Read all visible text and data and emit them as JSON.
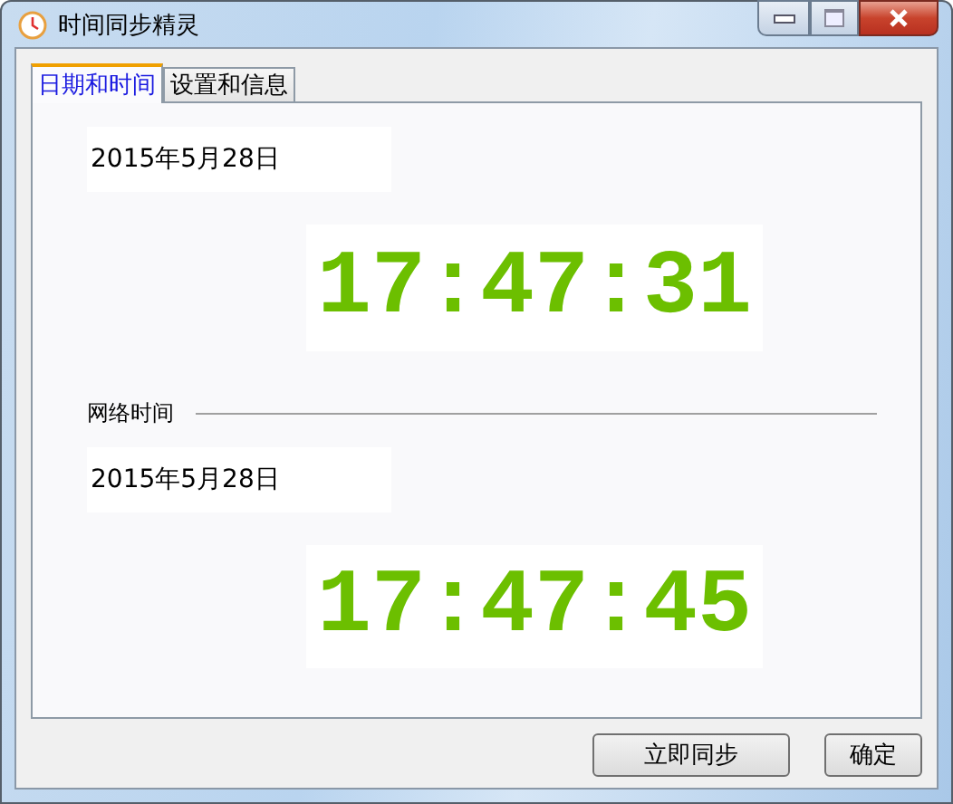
{
  "window": {
    "title": "时间同步精灵"
  },
  "tabs": [
    {
      "label": "日期和时间",
      "selected": true
    },
    {
      "label": "设置和信息",
      "selected": false
    }
  ],
  "local": {
    "date": "2015年5月28日",
    "time": "17:47:31"
  },
  "network": {
    "heading": "网络时间",
    "date": "2015年5月28日",
    "time": "17:47:45"
  },
  "buttons": [
    "立即同步",
    "确定"
  ]
}
